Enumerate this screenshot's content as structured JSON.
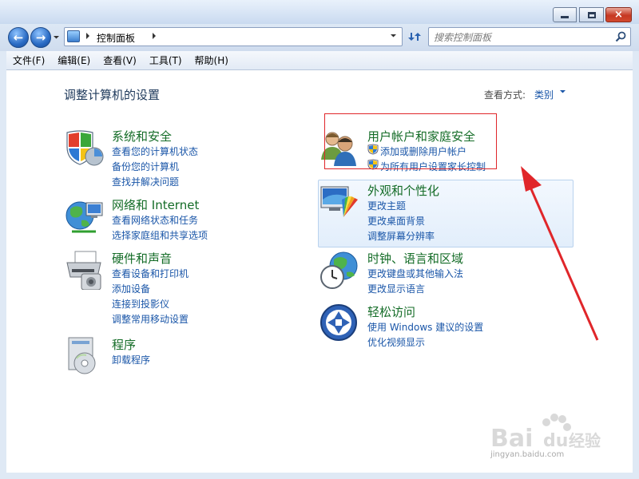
{
  "window": {
    "close_glyph": "×"
  },
  "nav": {
    "back_glyph": "←",
    "forward_glyph": "→",
    "address_label": "控制面板",
    "search_placeholder": "搜索控制面板"
  },
  "menu": {
    "items": [
      "文件(F)",
      "编辑(E)",
      "查看(V)",
      "工具(T)",
      "帮助(H)"
    ]
  },
  "content": {
    "title": "调整计算机的设置",
    "view_by_label": "查看方式:",
    "view_by_value": "类别"
  },
  "categories": [
    {
      "title": "系统和安全",
      "icon": "shield-icon",
      "links": [
        "查看您的计算机状态",
        "备份您的计算机",
        "查找并解决问题"
      ]
    },
    {
      "title": "网络和 Internet",
      "icon": "network-globe-icon",
      "links": [
        "查看网络状态和任务",
        "选择家庭组和共享选项"
      ]
    },
    {
      "title": "硬件和声音",
      "icon": "printer-icon",
      "links": [
        "查看设备和打印机",
        "添加设备",
        "连接到投影仪",
        "调整常用移动设置"
      ]
    },
    {
      "title": "程序",
      "icon": "programs-icon",
      "links": [
        "卸载程序"
      ]
    },
    {
      "title": "用户帐户和家庭安全",
      "icon": "users-icon",
      "links": [
        "添加或删除用户帐户",
        "为所有用户设置家长控制"
      ]
    },
    {
      "title": "外观和个性化",
      "icon": "appearance-icon",
      "links": [
        "更改主题",
        "更改桌面背景",
        "调整屏幕分辨率"
      ]
    },
    {
      "title": "时钟、语言和区域",
      "icon": "clock-globe-icon",
      "links": [
        "更改键盘或其他输入法",
        "更改显示语言"
      ]
    },
    {
      "title": "轻松访问",
      "icon": "ease-of-access-icon",
      "links": [
        "使用 Windows 建议的设置",
        "优化视频显示"
      ]
    }
  ],
  "watermark": {
    "brand": "Bai",
    "brand2": "du",
    "brand3": "经验",
    "url": "jingyan.baidu.com"
  }
}
